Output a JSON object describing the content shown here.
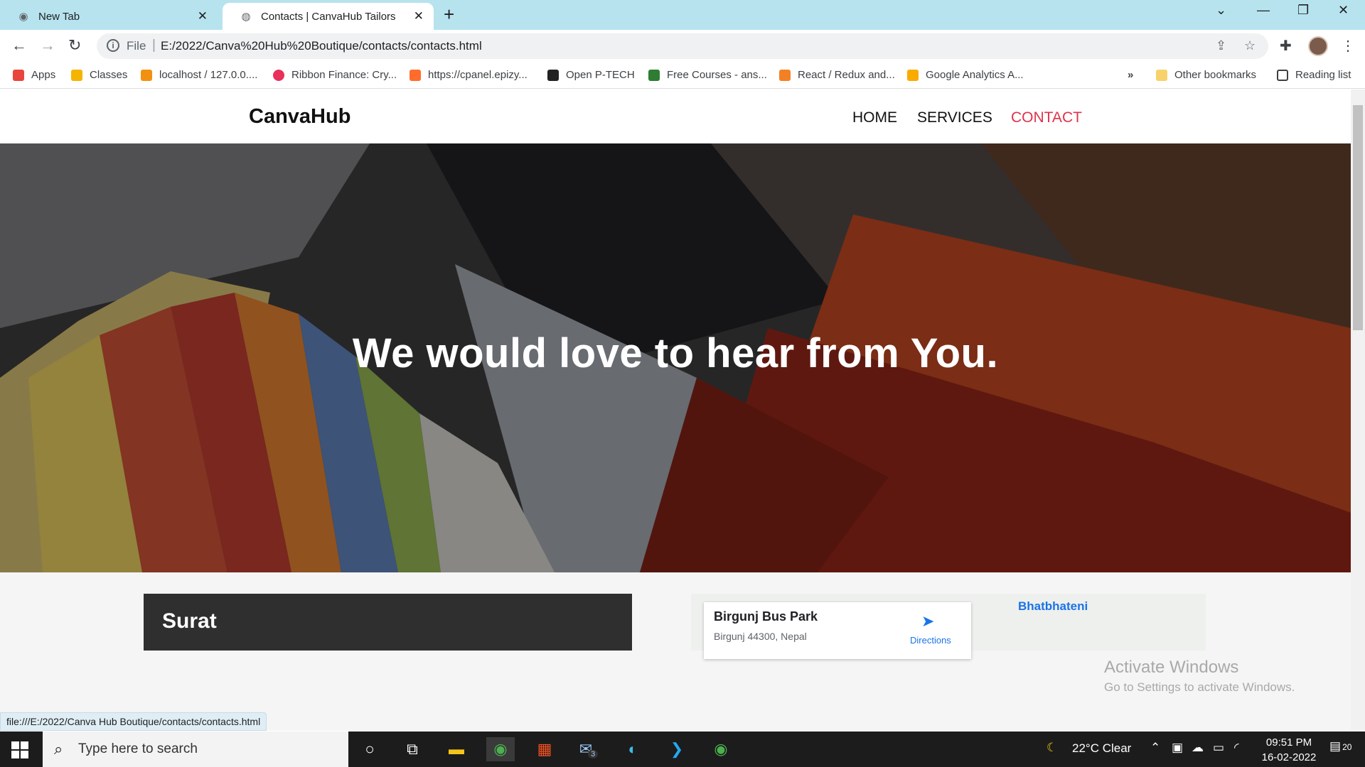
{
  "browser": {
    "tabs": [
      {
        "title": "New Tab",
        "active": false
      },
      {
        "title": "Contacts | CanvaHub Tailors",
        "active": true
      }
    ],
    "address": {
      "scheme": "File",
      "url": "E:/2022/Canva%20Hub%20Boutique/contacts/contacts.html"
    },
    "bookmarks": [
      {
        "label": "Apps",
        "icon": "apps-grid-icon",
        "color": "#e8453c"
      },
      {
        "label": "Classes",
        "icon": "classroom-icon",
        "color": "#f4b400"
      },
      {
        "label": "localhost / 127.0.0....",
        "icon": "phpmyadmin-icon",
        "color": "#f29111"
      },
      {
        "label": "Ribbon Finance: Cry...",
        "icon": "ribbon-icon",
        "color": "#e8305b"
      },
      {
        "label": "https://cpanel.epizy...",
        "icon": "cpanel-icon",
        "color": "#ff6c2c"
      },
      {
        "label": "Open P-TECH",
        "icon": "ptech-icon",
        "color": "#222222"
      },
      {
        "label": "Free Courses - ans...",
        "icon": "courses-icon",
        "color": "#2e7d32"
      },
      {
        "label": "React / Redux and...",
        "icon": "react-icon",
        "color": "#f48024"
      },
      {
        "label": "Google Analytics A...",
        "icon": "analytics-icon",
        "color": "#f9ab00"
      }
    ],
    "other_bookmarks": "Other bookmarks",
    "reading_list": "Reading list",
    "status_url": "file:///E:/2022/Canva Hub Boutique/contacts/contacts.html"
  },
  "site": {
    "brand": "CanvaHub",
    "nav": [
      {
        "label": "HOME",
        "active": false
      },
      {
        "label": "SERVICES",
        "active": false
      },
      {
        "label": "CONTACT",
        "active": true
      }
    ],
    "active_color": "#e0324b",
    "hero_title": "We would love to hear from You.",
    "city_card": "Surat",
    "map": {
      "place": "Birgunj Bus Park",
      "address": "Birgunj 44300, Nepal",
      "directions": "Directions",
      "nearby_label": "Bhatbhateni"
    }
  },
  "watermark": {
    "line1": "Activate Windows",
    "line2": "Go to Settings to activate Windows."
  },
  "taskbar": {
    "search_placeholder": "Type here to search",
    "weather": "22°C  Clear",
    "time": "09:51 PM",
    "date": "16-02-2022",
    "notification_count": "20",
    "mail_badge": "3"
  }
}
